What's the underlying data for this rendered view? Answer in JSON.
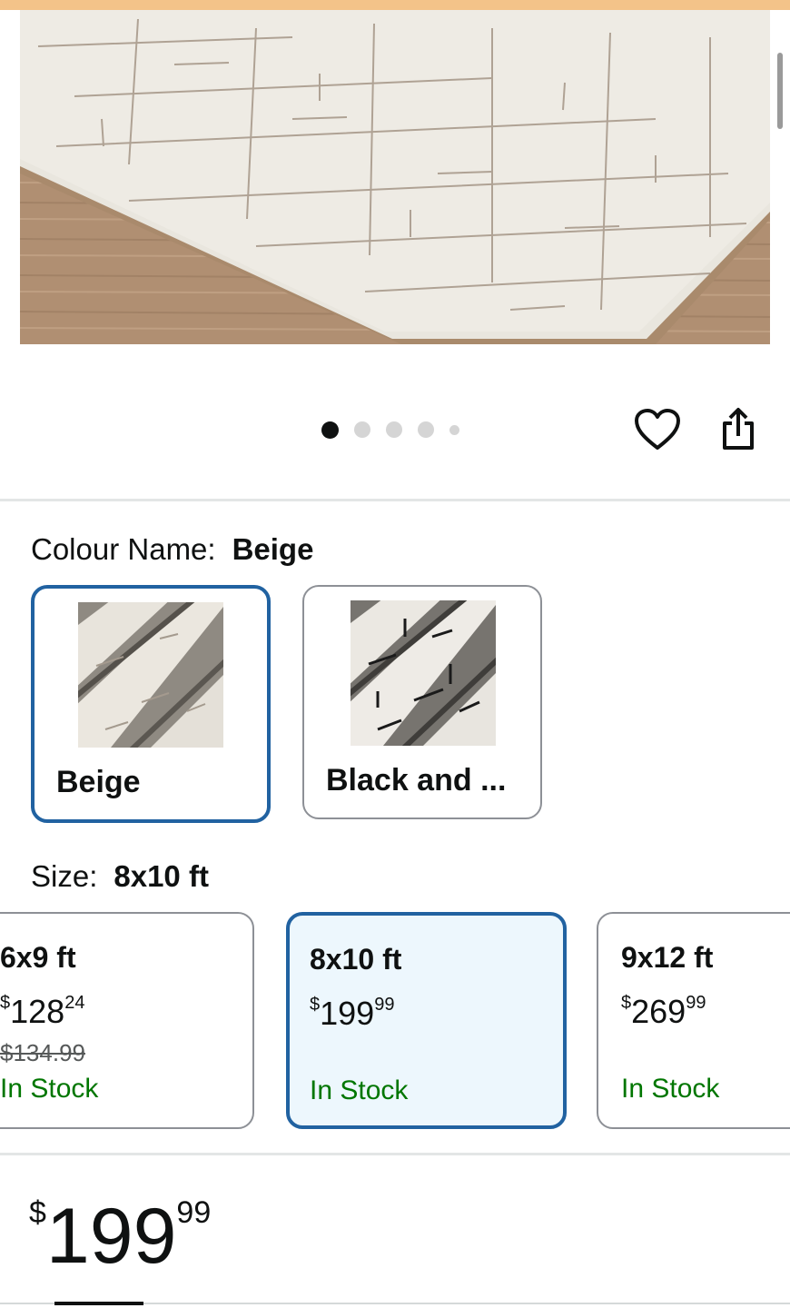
{
  "colors": {
    "accent_border": "#2162a1",
    "selected_bg": "#edf7fd",
    "in_stock": "#007600",
    "top_bar": "#f3c389"
  },
  "gallery": {
    "image_count": 5,
    "active_index": 0,
    "wishlist_icon": "heart-icon",
    "share_icon": "share-icon"
  },
  "colour": {
    "label": "Colour Name:",
    "selected": "Beige",
    "options": [
      {
        "name": "Beige",
        "selected": true
      },
      {
        "name": "Black and ...",
        "selected": false
      }
    ]
  },
  "size": {
    "label": "Size:",
    "selected": "8x10 ft",
    "options": [
      {
        "name": "6x9 ft",
        "currency": "$",
        "whole": "128",
        "fraction": "24",
        "list_price": "$134.99",
        "availability": "In Stock",
        "selected": false
      },
      {
        "name": "8x10 ft",
        "currency": "$",
        "whole": "199",
        "fraction": "99",
        "availability": "In Stock",
        "selected": true
      },
      {
        "name": "9x12 ft",
        "currency": "$",
        "whole": "269",
        "fraction": "99",
        "availability": "In Stock",
        "selected": false
      }
    ]
  },
  "price": {
    "currency": "$",
    "whole": "199",
    "fraction": "99"
  }
}
